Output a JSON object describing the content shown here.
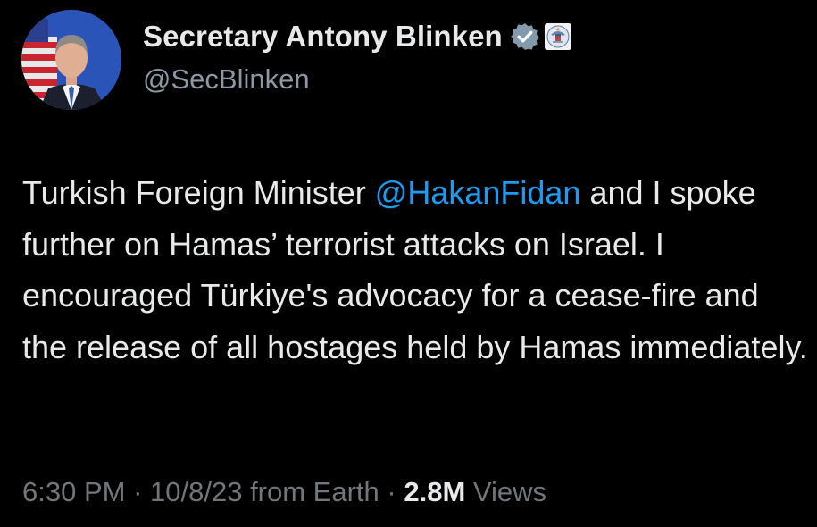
{
  "author": {
    "display_name": "Secretary Antony Blinken",
    "handle": "@SecBlinken",
    "verified_icon": "verified-badge-icon",
    "affiliation_icon": "us-state-department-seal-icon"
  },
  "tweet": {
    "text_before_mention": "Turkish Foreign Minister ",
    "mention": "@HakanFidan",
    "text_after_mention": " and I spoke further on Hamas’ terrorist attacks on Israel. I encouraged Türkiye's advocacy for a cease-fire and the release of all hostages held by Hamas immediately."
  },
  "meta": {
    "time": "6:30 PM",
    "separator1": " · ",
    "date": "10/8/23",
    "source": " from Earth",
    "separator2": " · ",
    "views_count": "2.8M",
    "views_label": " Views"
  },
  "colors": {
    "background": "#000000",
    "text_primary": "#e7e9ea",
    "text_secondary": "#71767b",
    "link": "#1d9bf0"
  }
}
